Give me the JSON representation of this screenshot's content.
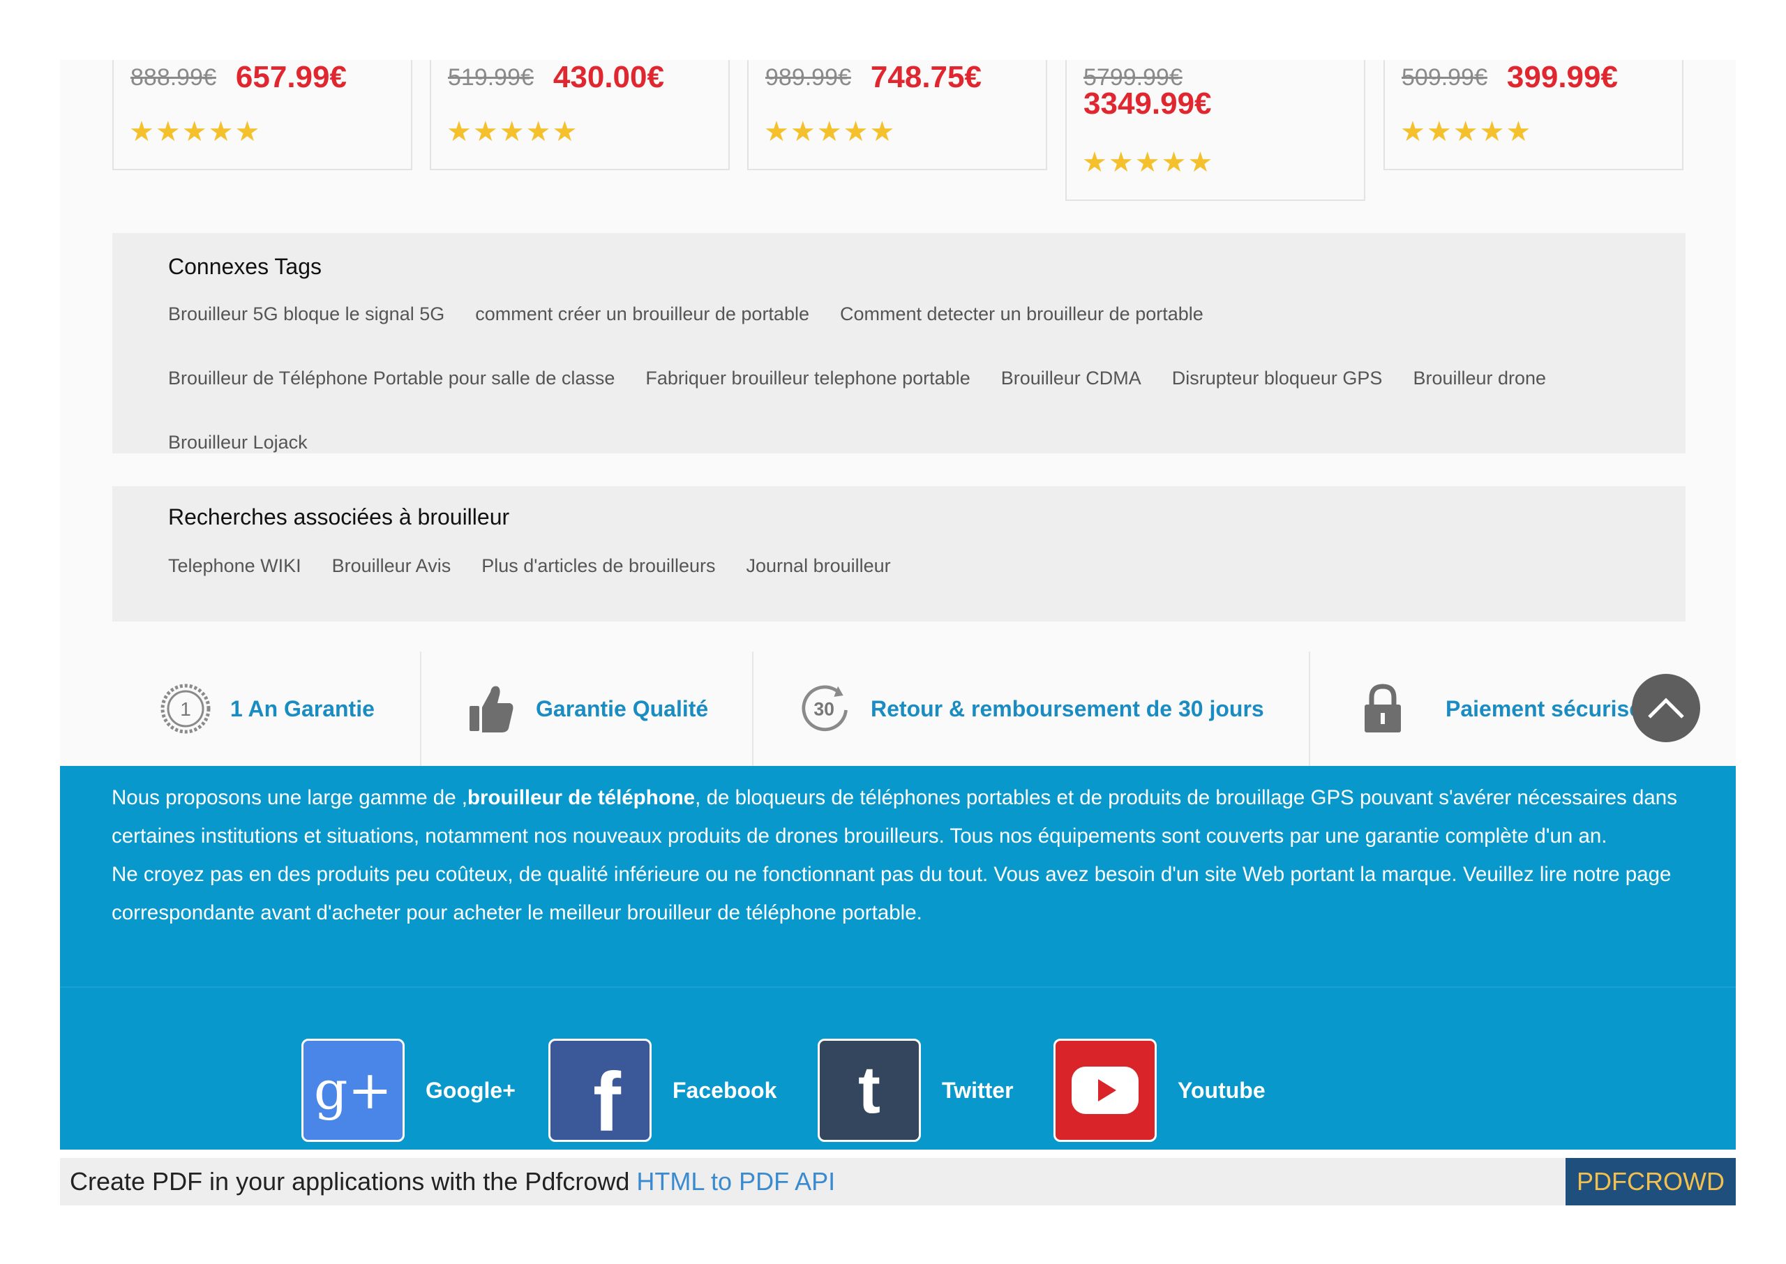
{
  "products": [
    {
      "old_price": "888.99€",
      "new_price": "657.99€",
      "stars": "★★★★★"
    },
    {
      "old_price": "519.99€",
      "new_price": "430.00€",
      "stars": "★★★★★"
    },
    {
      "old_price": "989.99€",
      "new_price": "748.75€",
      "stars": "★★★★★"
    },
    {
      "old_price": "5799.99€",
      "new_price": "3349.99€",
      "stars": "★★★★★"
    },
    {
      "old_price": "509.99€",
      "new_price": "399.99€",
      "stars": "★★★★★"
    }
  ],
  "tags_panel": {
    "title": "Connexes Tags",
    "tags": [
      "Brouilleur 5G bloque le signal 5G",
      "comment créer un brouilleur de portable",
      "Comment detecter un brouilleur de portable",
      "Brouilleur de Téléphone Portable pour salle de classe",
      "Fabriquer brouilleur telephone portable",
      "Brouilleur CDMA",
      "Disrupteur bloqueur GPS",
      "Brouilleur drone",
      "Brouilleur Lojack"
    ]
  },
  "related_panel": {
    "title": "Recherches associées à brouilleur",
    "links": [
      "Telephone WIKI",
      "Brouilleur Avis",
      "Plus d'articles de brouilleurs",
      "Journal brouilleur"
    ]
  },
  "features": [
    {
      "label": "1 An Garantie",
      "icon": "one-year-badge-icon",
      "icon_text": "1"
    },
    {
      "label": "Garantie Qualité",
      "icon": "thumbs-up-icon"
    },
    {
      "label": "Retour & remboursement de 30 jours",
      "icon": "return-30-days-icon",
      "icon_text": "30"
    },
    {
      "label": "Paiement sécurisé",
      "icon": "lock-icon"
    }
  ],
  "info": {
    "p1_before": "Nous proposons une large gamme de ,",
    "p1_bold": "brouilleur de téléphone",
    "p1_after": ", de bloqueurs de téléphones portables et de produits de brouillage GPS pouvant s'avérer nécessaires dans certaines institutions et situations, notamment nos nouveaux produits de drones brouilleurs. Tous nos équipements sont couverts par une garantie complète d'un an.",
    "p2": "Ne croyez pas en des produits peu coûteux, de qualité inférieure ou ne fonctionnant pas du tout. Vous avez besoin d'un site Web portant la marque. Veuillez lire notre page correspondante avant d'acheter pour acheter le meilleur brouilleur de téléphone portable."
  },
  "social": [
    {
      "label": "Google+",
      "icon": "google-plus-icon",
      "color": "#4a86e8",
      "glyph": "g+"
    },
    {
      "label": "Facebook",
      "icon": "facebook-icon",
      "color": "#3b5998",
      "glyph": "f"
    },
    {
      "label": "Twitter",
      "icon": "tumblr-icon",
      "color": "#34465d",
      "glyph": "t"
    },
    {
      "label": "Youtube",
      "icon": "youtube-icon",
      "color": "#d9252a"
    }
  ],
  "pdf_footer": {
    "text": "Create PDF in your applications with the Pdfcrowd ",
    "link": "HTML to PDF API",
    "badge": "PDFCROWD"
  },
  "colors": {
    "price_red": "#e0262e",
    "star_gold": "#f4c02c",
    "feature_blue": "#1a8cc2",
    "info_blue": "#0998cb"
  }
}
